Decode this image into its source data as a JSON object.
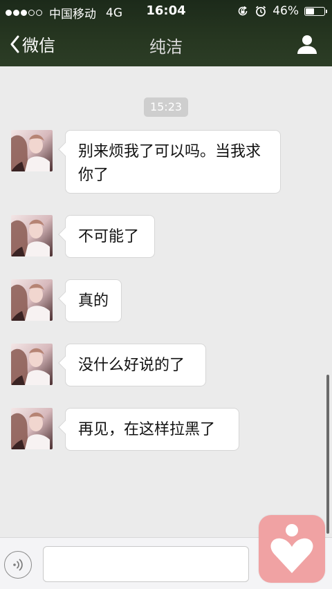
{
  "status_bar": {
    "carrier": "中国移动",
    "network": "4G",
    "time": "16:04",
    "battery": "46%",
    "battery_level": 0.46,
    "signal_bars_filled": 3,
    "signal_bars_total": 5
  },
  "nav": {
    "back_label": "微信",
    "title": "纯洁"
  },
  "chat": {
    "timestamp": "15:23",
    "messages": [
      {
        "text": "别来烦我了可以吗。当我求你了"
      },
      {
        "text": "不可能了"
      },
      {
        "text": "真的"
      },
      {
        "text": "没什么好说的了"
      },
      {
        "text": "再见，在这样拉黑了"
      }
    ]
  },
  "input_bar": {
    "value": "",
    "placeholder": ""
  },
  "icons": {
    "back": "chevron-left-icon",
    "profile": "person-icon",
    "voice": "voice-icon",
    "floating": "heart-icon",
    "rotation_lock": "rotation-lock-icon",
    "alarm": "alarm-icon",
    "battery": "battery-icon"
  },
  "colors": {
    "nav_background": "#263620",
    "chat_background": "#ebebeb",
    "timestamp_background": "#cecece",
    "floating_button": "#f0a2a3"
  }
}
